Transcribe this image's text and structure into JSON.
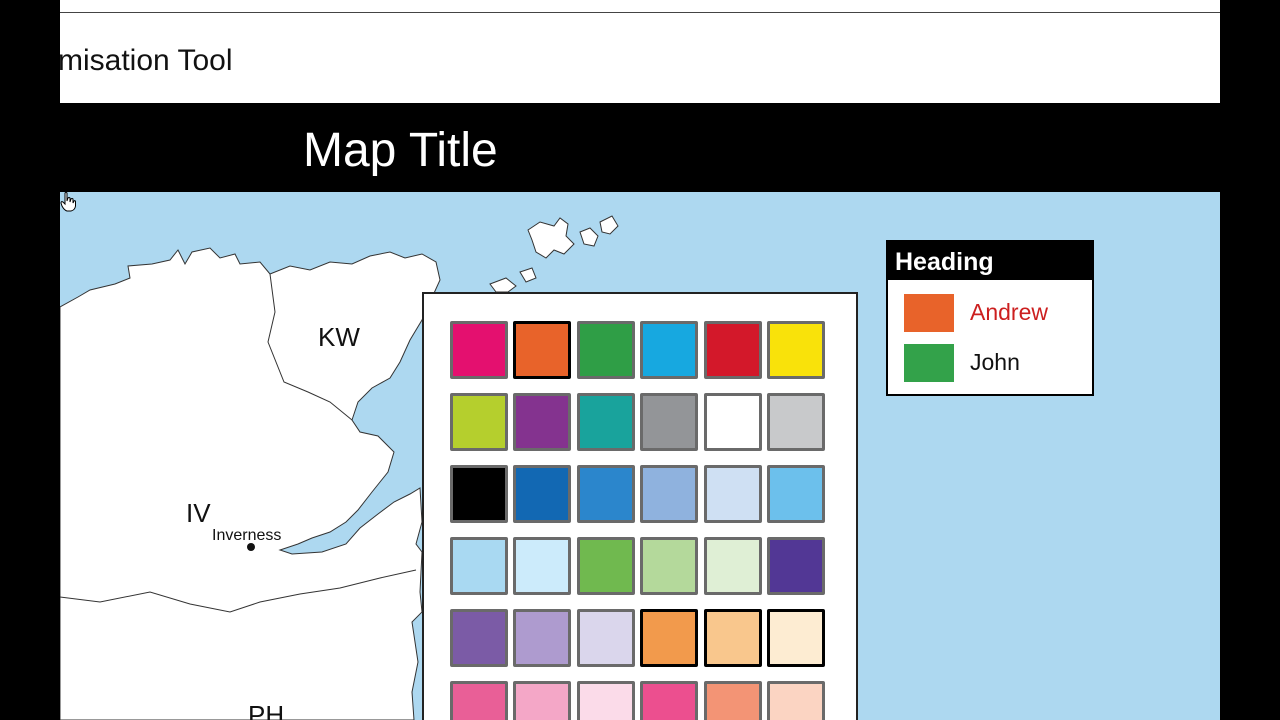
{
  "app": {
    "title": "misation Tool"
  },
  "map": {
    "title": "Map Title",
    "regions": [
      "KW",
      "IV",
      "PH"
    ],
    "towns": [
      "Inverness"
    ],
    "sea_color": "#add8f0",
    "land_color": "#ffffff"
  },
  "legend": {
    "heading": "Heading",
    "items": [
      {
        "label": "Andrew",
        "color": "#e8632a",
        "label_color": "#cc1f1f"
      },
      {
        "label": "John",
        "color": "#33a24a",
        "label_color": "#111111"
      }
    ]
  },
  "palette": {
    "rows": [
      [
        "#e4106f",
        "#e8632a",
        "#2f9e46",
        "#17a8e0",
        "#d3182a",
        "#f9e20a"
      ],
      [
        "#b5cf2d",
        "#84338f",
        "#19a39c",
        "#939598",
        "#ffffff",
        "#c8c9cb"
      ],
      [
        "#000000",
        "#1268b3",
        "#2b86cc",
        "#8fb2de",
        "#cfe0f3",
        "#6cc0ec"
      ],
      [
        "#a9d9f2",
        "#ccebfb",
        "#70b94f",
        "#b4d99b",
        "#dfefd5",
        "#523795"
      ],
      [
        "#7b5ba6",
        "#ae9bcf",
        "#dad6ec",
        "#f29a4c",
        "#f9c78d",
        "#fdecd2"
      ],
      [
        "#e95f97",
        "#f4a7c7",
        "#fbdbe9",
        "#ec4f8f",
        "#f39475",
        "#fbd4c2"
      ]
    ],
    "selected": [
      "#e8632a",
      "#f29a4c",
      "#f9c78d",
      "#fdecd2"
    ],
    "hovered": "#d3182a"
  }
}
